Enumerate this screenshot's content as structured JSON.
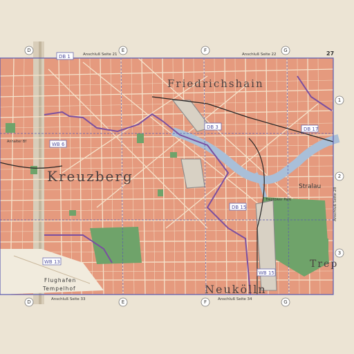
{
  "page_number": "27",
  "district_labels": {
    "friedrichshain": "Friedrichshain",
    "kreuzberg": "Kreuzberg",
    "neukoelln": "Neukölln",
    "treptow": "Trep",
    "stralau": "Stralau"
  },
  "adjacent_page_refs": {
    "top_left": "Anschluß Seite 21",
    "top_right": "Anschluß Seite 22",
    "bottom_left": "Anschluß Seite 33",
    "bottom_right": "Anschluß Seite 34",
    "right_side": "Anschluß Seite 28"
  },
  "grid_columns": [
    "D",
    "E",
    "F",
    "G"
  ],
  "grid_rows": [
    "1",
    "2",
    "3"
  ],
  "zone_boxes": [
    "DB 1",
    "DB 17",
    "DB 15",
    "WB 6",
    "WB 13",
    "WB 15",
    "DB 3"
  ],
  "place_labels": {
    "airport_line1": "Flughafen",
    "airport_line2": "Tempelhof",
    "park": "Treptower Park",
    "anhalter": "Anhalter Bf"
  },
  "colors": {
    "paper": "#e9e1d2",
    "block": "#e59a7e",
    "street": "#f4dfc8",
    "park": "#6fa36a",
    "water": "#a9bfd8",
    "boundary": "#7a4fa0",
    "grid_line": "#5a5ab0"
  }
}
